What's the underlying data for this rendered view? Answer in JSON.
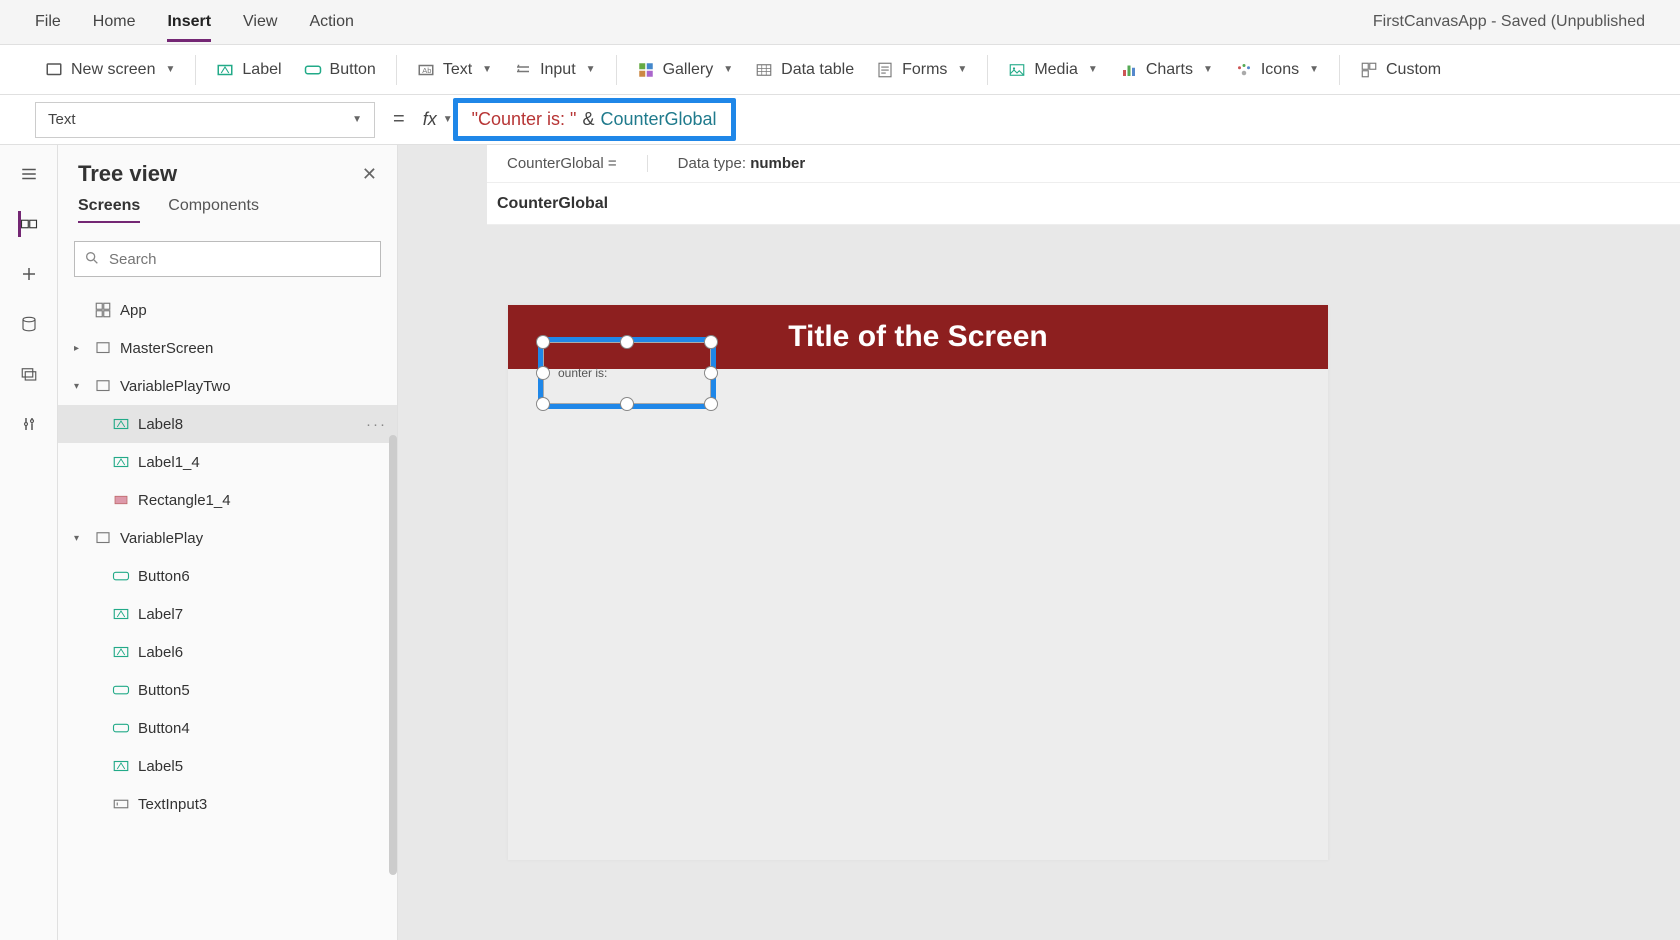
{
  "appTitle": "FirstCanvasApp - Saved (Unpublished",
  "menu": {
    "items": [
      "File",
      "Home",
      "Insert",
      "View",
      "Action"
    ],
    "active": "Insert"
  },
  "ribbon": {
    "newScreen": "New screen",
    "label": "Label",
    "button": "Button",
    "text": "Text",
    "input": "Input",
    "gallery": "Gallery",
    "dataTable": "Data table",
    "forms": "Forms",
    "media": "Media",
    "charts": "Charts",
    "icons": "Icons",
    "custom": "Custom"
  },
  "formula": {
    "property": "Text",
    "fx": "fx",
    "strLit": "\"Counter is: \"",
    "amp": "&",
    "varRef": "CounterGlobal"
  },
  "infoRow": {
    "left": "CounterGlobal  =",
    "dataTypeLabel": "Data type: ",
    "dataType": "number",
    "varName": "CounterGlobal"
  },
  "treePanel": {
    "title": "Tree view",
    "tabs": {
      "screens": "Screens",
      "components": "Components"
    },
    "searchPlaceholder": "Search",
    "items": [
      {
        "name": "App",
        "icon": "app",
        "indent": 0,
        "caret": ""
      },
      {
        "name": "MasterScreen",
        "icon": "screen",
        "indent": 0,
        "caret": "right"
      },
      {
        "name": "VariablePlayTwo",
        "icon": "screen",
        "indent": 0,
        "caret": "down"
      },
      {
        "name": "Label8",
        "icon": "label",
        "indent": 1,
        "selected": true,
        "more": true
      },
      {
        "name": "Label1_4",
        "icon": "label",
        "indent": 1
      },
      {
        "name": "Rectangle1_4",
        "icon": "rect",
        "indent": 1
      },
      {
        "name": "VariablePlay",
        "icon": "screen",
        "indent": 0,
        "caret": "down"
      },
      {
        "name": "Button6",
        "icon": "button",
        "indent": 1
      },
      {
        "name": "Label7",
        "icon": "label",
        "indent": 1
      },
      {
        "name": "Label6",
        "icon": "label",
        "indent": 1
      },
      {
        "name": "Button5",
        "icon": "button",
        "indent": 1
      },
      {
        "name": "Button4",
        "icon": "button",
        "indent": 1
      },
      {
        "name": "Label5",
        "icon": "label",
        "indent": 1
      },
      {
        "name": "TextInput3",
        "icon": "textinput",
        "indent": 1
      }
    ]
  },
  "canvas": {
    "screenTitle": "Title of the Screen",
    "selectedLabelText": "ounter is:"
  }
}
